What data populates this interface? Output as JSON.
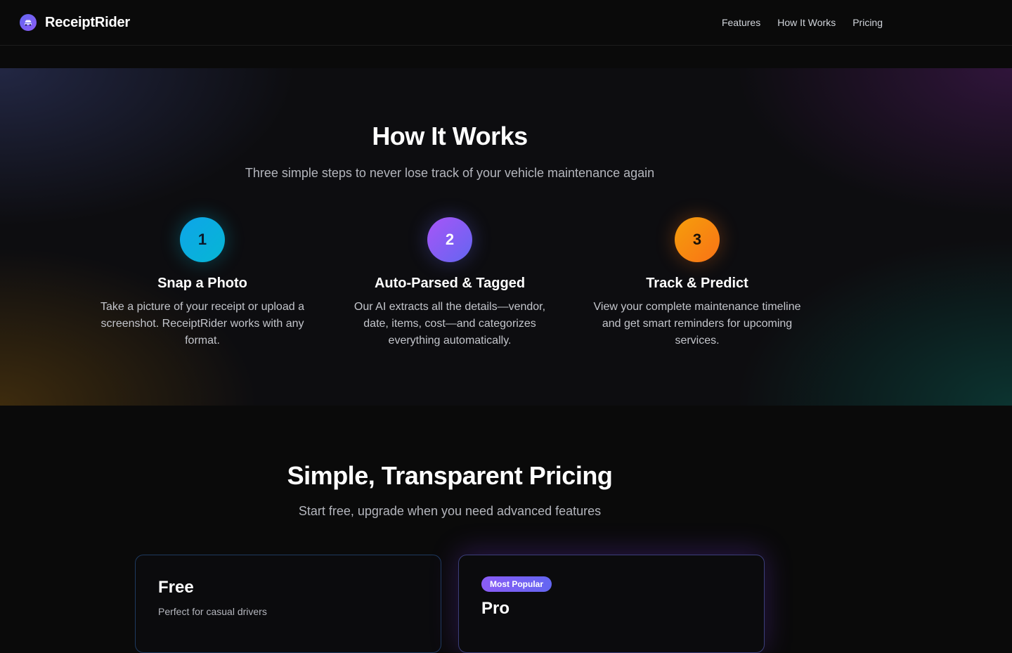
{
  "nav": {
    "brand": "ReceiptRider",
    "links": [
      "Features",
      "How It Works",
      "Pricing"
    ]
  },
  "how_it_works": {
    "title": "How It Works",
    "subtitle": "Three simple steps to never lose track of your vehicle maintenance again",
    "steps": [
      {
        "number": "1",
        "title": "Snap a Photo",
        "description": "Take a picture of your receipt or upload a screenshot. ReceiptRider works with any format.",
        "color_from": "#0ea5e9",
        "color_to": "#06b6d4"
      },
      {
        "number": "2",
        "title": "Auto-Parsed & Tagged",
        "description": "Our AI extracts all the details—vendor, date, items, cost—and categorizes everything automatically.",
        "color_from": "#a855f7",
        "color_to": "#6366f1"
      },
      {
        "number": "3",
        "title": "Track & Predict",
        "description": "View your complete maintenance timeline and get smart reminders for upcoming services.",
        "color_from": "#f59e0b",
        "color_to": "#f97316"
      }
    ]
  },
  "pricing": {
    "title": "Simple, Transparent Pricing",
    "subtitle": "Start free, upgrade when you need advanced features",
    "plans": [
      {
        "name": "Free",
        "description": "Perfect for casual drivers"
      },
      {
        "name": "Pro",
        "badge": "Most Popular"
      }
    ]
  }
}
